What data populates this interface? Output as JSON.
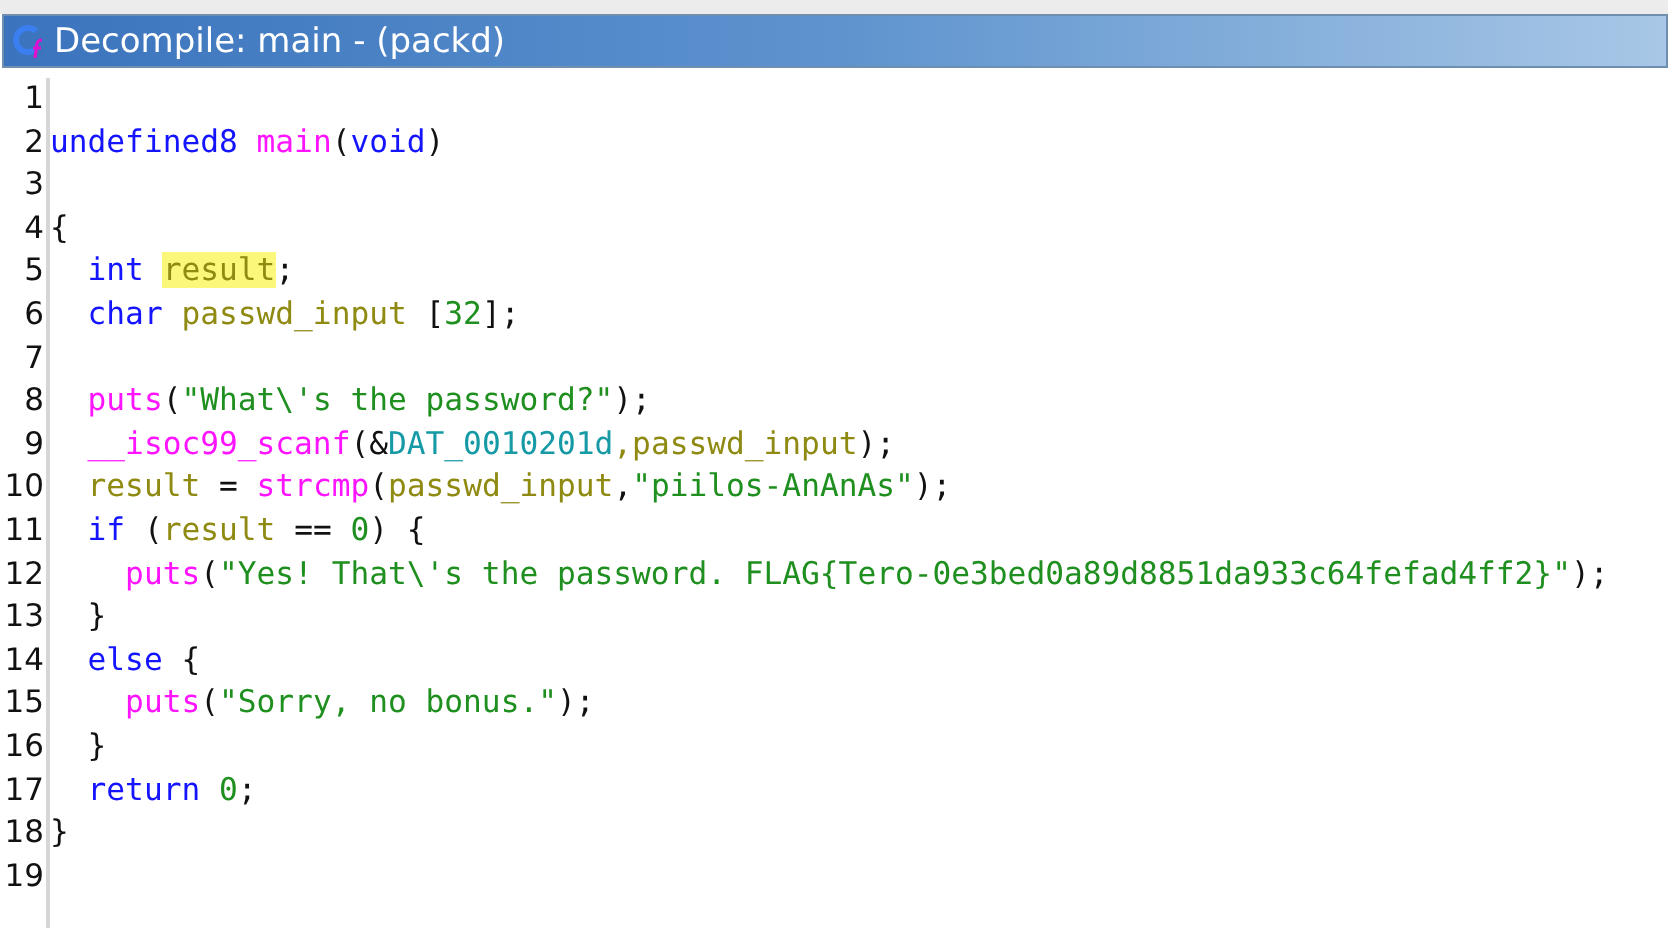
{
  "window": {
    "title": "Decompile: main - (packd)"
  },
  "lines": [
    {
      "number": "1"
    },
    {
      "number": "2",
      "tokens": [
        {
          "text": "undefined8 ",
          "kind": "type"
        },
        {
          "text": "main",
          "kind": "func"
        },
        {
          "text": "(",
          "kind": "plain"
        },
        {
          "text": "void",
          "kind": "type"
        },
        {
          "text": ")",
          "kind": "plain"
        }
      ]
    },
    {
      "number": "3"
    },
    {
      "number": "4",
      "tokens": [
        {
          "text": "{",
          "kind": "plain"
        }
      ]
    },
    {
      "number": "5",
      "tokens": [
        {
          "text": "  int ",
          "kind": "type"
        },
        {
          "text": "result",
          "kind": "var",
          "highlighted": true
        },
        {
          "text": ";",
          "kind": "plain"
        }
      ]
    },
    {
      "number": "6",
      "tokens": [
        {
          "text": "  char ",
          "kind": "type"
        },
        {
          "text": "passwd_input",
          "kind": "var"
        },
        {
          "text": " [",
          "kind": "plain"
        },
        {
          "text": "32",
          "kind": "num"
        },
        {
          "text": "];",
          "kind": "plain"
        }
      ]
    },
    {
      "number": "7"
    },
    {
      "number": "8",
      "tokens": [
        {
          "text": "  puts",
          "kind": "func"
        },
        {
          "text": "(",
          "kind": "plain"
        },
        {
          "text": "\"What\\'s the password?\"",
          "kind": "str"
        },
        {
          "text": ");",
          "kind": "plain"
        }
      ]
    },
    {
      "number": "9",
      "tokens": [
        {
          "text": "  __isoc99_scanf",
          "kind": "func"
        },
        {
          "text": "(&",
          "kind": "plain"
        },
        {
          "text": "DAT_0010201d",
          "kind": "global"
        },
        {
          "text": ",passwd_input",
          "kind": "var"
        },
        {
          "text": ");",
          "kind": "plain"
        }
      ]
    },
    {
      "number": "10",
      "tokens": [
        {
          "text": "  result",
          "kind": "var"
        },
        {
          "text": " = ",
          "kind": "plain"
        },
        {
          "text": "strcmp",
          "kind": "func"
        },
        {
          "text": "(",
          "kind": "plain"
        },
        {
          "text": "passwd_input",
          "kind": "var"
        },
        {
          "text": ",",
          "kind": "plain"
        },
        {
          "text": "\"piilos-AnAnAs\"",
          "kind": "str"
        },
        {
          "text": ");",
          "kind": "plain"
        }
      ]
    },
    {
      "number": "11",
      "tokens": [
        {
          "text": "  if ",
          "kind": "type"
        },
        {
          "text": "(",
          "kind": "plain"
        },
        {
          "text": "result",
          "kind": "var"
        },
        {
          "text": " == ",
          "kind": "plain"
        },
        {
          "text": "0",
          "kind": "num"
        },
        {
          "text": ") {",
          "kind": "plain"
        }
      ]
    },
    {
      "number": "12",
      "tokens": [
        {
          "text": "    puts",
          "kind": "func"
        },
        {
          "text": "(",
          "kind": "plain"
        },
        {
          "text": "\"Yes! That\\'s the password. FLAG{Tero-0e3bed0a89d8851da933c64fefad4ff2}\"",
          "kind": "str"
        },
        {
          "text": ");",
          "kind": "plain"
        }
      ]
    },
    {
      "number": "13",
      "tokens": [
        {
          "text": "  }",
          "kind": "plain"
        }
      ]
    },
    {
      "number": "14",
      "tokens": [
        {
          "text": "  else ",
          "kind": "type"
        },
        {
          "text": "{",
          "kind": "plain"
        }
      ]
    },
    {
      "number": "15",
      "tokens": [
        {
          "text": "    puts",
          "kind": "func"
        },
        {
          "text": "(",
          "kind": "plain"
        },
        {
          "text": "\"Sorry, no bonus.\"",
          "kind": "str"
        },
        {
          "text": ");",
          "kind": "plain"
        }
      ]
    },
    {
      "number": "16",
      "tokens": [
        {
          "text": "  }",
          "kind": "plain"
        }
      ]
    },
    {
      "number": "17",
      "tokens": [
        {
          "text": "  return ",
          "kind": "type"
        },
        {
          "text": "0",
          "kind": "num"
        },
        {
          "text": ";",
          "kind": "plain"
        }
      ]
    },
    {
      "number": "18",
      "tokens": [
        {
          "text": "}",
          "kind": "plain"
        }
      ]
    },
    {
      "number": "19"
    }
  ]
}
